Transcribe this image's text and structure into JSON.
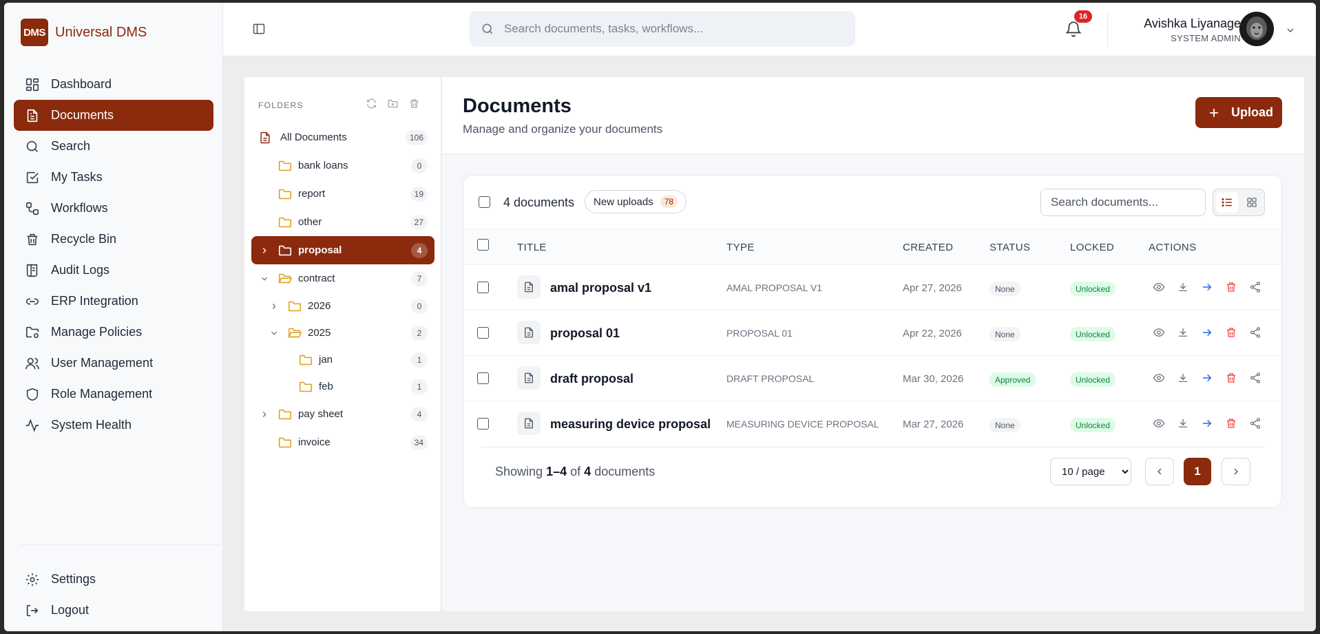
{
  "brand": {
    "logo": "DMS",
    "name": "Universal DMS",
    "color": "#8b2a0d"
  },
  "sidebar": {
    "items": [
      {
        "label": "Dashboard",
        "icon": "dashboard-icon"
      },
      {
        "label": "Documents",
        "icon": "document-icon",
        "active": true
      },
      {
        "label": "Search",
        "icon": "search-icon"
      },
      {
        "label": "My Tasks",
        "icon": "checkbox-icon"
      },
      {
        "label": "Workflows",
        "icon": "workflow-icon"
      },
      {
        "label": "Recycle Bin",
        "icon": "trash-icon"
      },
      {
        "label": "Audit Logs",
        "icon": "logs-icon"
      },
      {
        "label": "ERP Integration",
        "icon": "link-icon"
      },
      {
        "label": "Manage Policies",
        "icon": "folder-settings-icon"
      },
      {
        "label": "User Management",
        "icon": "users-icon"
      },
      {
        "label": "Role Management",
        "icon": "shield-icon"
      },
      {
        "label": "System Health",
        "icon": "activity-icon"
      }
    ],
    "bottom": [
      {
        "label": "Settings",
        "icon": "gear-icon"
      },
      {
        "label": "Logout",
        "icon": "logout-icon"
      }
    ]
  },
  "topbar": {
    "search_placeholder": "Search documents, tasks, workflows...",
    "notifications": "16",
    "user_name": "Avishka Liyanage",
    "user_role": "SYSTEM ADMIN"
  },
  "folders": {
    "heading": "FOLDERS",
    "all": {
      "label": "All Documents",
      "count": "106"
    },
    "tree": [
      {
        "label": "bank loans",
        "count": "0"
      },
      {
        "label": "report",
        "count": "19"
      },
      {
        "label": "other",
        "count": "27"
      },
      {
        "label": "proposal",
        "count": "4"
      },
      {
        "label": "contract",
        "count": "7"
      },
      {
        "label": "2026",
        "count": "0"
      },
      {
        "label": "2025",
        "count": "2"
      },
      {
        "label": "jan",
        "count": "1"
      },
      {
        "label": "feb",
        "count": "1"
      },
      {
        "label": "pay sheet",
        "count": "4"
      },
      {
        "label": "invoice",
        "count": "34"
      }
    ]
  },
  "page": {
    "title": "Documents",
    "subtitle": "Manage and organize your documents",
    "upload_label": "Upload"
  },
  "toolbar": {
    "count_label": "4 documents",
    "chip_label": "New uploads",
    "chip_count": "78",
    "search_placeholder": "Search documents..."
  },
  "table": {
    "headers": [
      "TITLE",
      "TYPE",
      "CREATED",
      "STATUS",
      "LOCKED",
      "ACTIONS"
    ],
    "rows": [
      {
        "title": "amal proposal v1",
        "type": "AMAL PROPOSAL V1",
        "created": "Apr 27, 2026",
        "status": "None",
        "locked": "Unlocked"
      },
      {
        "title": "proposal 01",
        "type": "PROPOSAL 01",
        "created": "Apr 22, 2026",
        "status": "None",
        "locked": "Unlocked"
      },
      {
        "title": "draft proposal",
        "type": "DRAFT PROPOSAL",
        "created": "Mar 30, 2026",
        "status": "Approved",
        "locked": "Unlocked"
      },
      {
        "title": "measuring device proposal",
        "type": "MEASURING DEVICE PROPOSAL",
        "created": "Mar 27, 2026",
        "status": "None",
        "locked": "Unlocked"
      }
    ]
  },
  "pagination": {
    "showing_prefix": "Showing",
    "range": "1–4",
    "of": "of",
    "total": "4",
    "suffix": "documents",
    "per_page": "10 / page",
    "current": "1"
  }
}
